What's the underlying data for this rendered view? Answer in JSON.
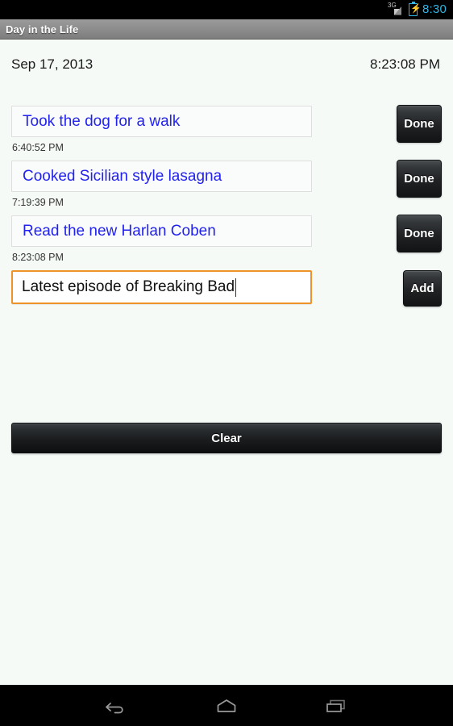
{
  "status_bar": {
    "network_label": "3G",
    "signal_icon": "signal-bars-icon",
    "battery_icon": "battery-charging-icon",
    "time": "8:30",
    "accent_color": "#33b5e5"
  },
  "title_bar": {
    "app_title": "Day in the Life"
  },
  "header": {
    "date": "Sep 17, 2013",
    "time": "8:23:08 PM"
  },
  "tasks": [
    {
      "text": "Took the dog for a walk",
      "time": "6:40:52 PM",
      "button_label": "Done"
    },
    {
      "text": "Cooked Sicilian style lasagna",
      "time": "7:19:39 PM",
      "button_label": "Done"
    },
    {
      "text": "Read the new Harlan Coben",
      "time": "8:23:08 PM",
      "button_label": "Done"
    }
  ],
  "new_task": {
    "value": "Latest episode of Breaking Bad",
    "placeholder": "",
    "add_label": "Add",
    "focus_color": "#f0922b"
  },
  "clear": {
    "label": "Clear"
  },
  "nav_bar": {
    "back_icon": "back-arrow-icon",
    "home_icon": "home-icon",
    "recents_icon": "recents-icon"
  },
  "colors": {
    "task_text": "#2222ee",
    "page_background": "#f5faf7"
  }
}
